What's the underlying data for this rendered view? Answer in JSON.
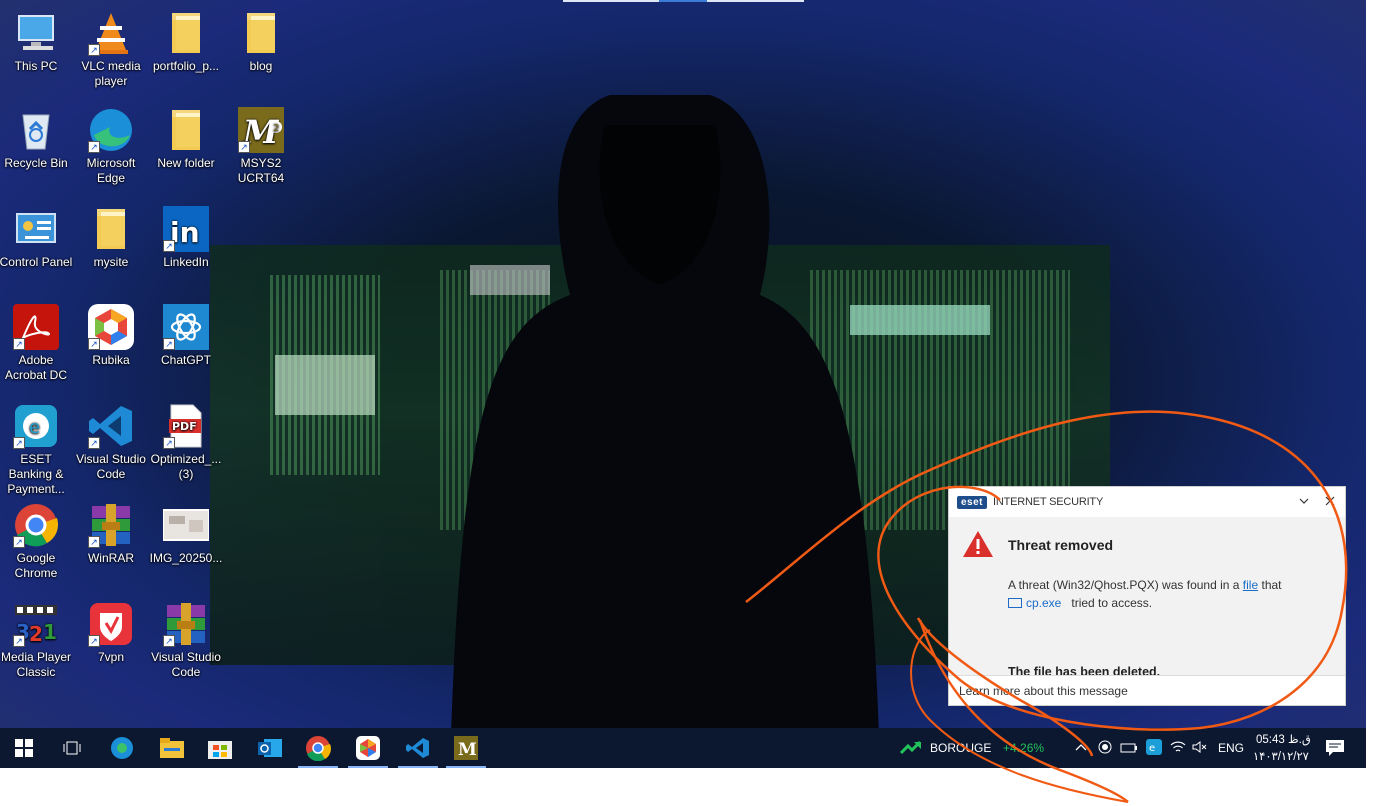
{
  "desktop": {
    "icons": [
      {
        "label": "This PC",
        "icon": "computer-icon"
      },
      {
        "label": "VLC media player",
        "icon": "vlc-icon"
      },
      {
        "label": "portfolio_p...",
        "icon": "folder-icon"
      },
      {
        "label": "blog",
        "icon": "folder-icon"
      },
      {
        "label": "Recycle Bin",
        "icon": "recycle-bin-icon"
      },
      {
        "label": "Microsoft Edge",
        "icon": "edge-icon"
      },
      {
        "label": "New folder",
        "icon": "folder-icon"
      },
      {
        "label": "MSYS2 UCRT64",
        "icon": "msys2-icon"
      },
      {
        "label": "Control Panel",
        "icon": "control-panel-icon"
      },
      {
        "label": "mysite",
        "icon": "folder-icon"
      },
      {
        "label": "LinkedIn",
        "icon": "linkedin-icon"
      },
      {
        "label": "Adobe Acrobat DC",
        "icon": "acrobat-icon"
      },
      {
        "label": "Rubika",
        "icon": "rubika-icon"
      },
      {
        "label": "ChatGPT",
        "icon": "chatgpt-icon"
      },
      {
        "label": "ESET Banking & Payment...",
        "icon": "eset-banking-icon"
      },
      {
        "label": "Visual Studio Code",
        "icon": "vscode-icon"
      },
      {
        "label": "Optimized_... (3)",
        "icon": "pdf-icon"
      },
      {
        "label": "Google Chrome",
        "icon": "chrome-icon"
      },
      {
        "label": "WinRAR",
        "icon": "winrar-icon"
      },
      {
        "label": "IMG_20250...",
        "icon": "image-thumbnail-icon"
      },
      {
        "label": "Media Player Classic",
        "icon": "mpc-icon"
      },
      {
        "label": "7vpn",
        "icon": "7vpn-icon"
      },
      {
        "label": "Visual Studio Code",
        "icon": "winrar-icon"
      }
    ]
  },
  "toast": {
    "logo": "eset",
    "product": "INTERNET SECURITY",
    "title": "Threat removed",
    "message_prefix": "A threat (Win32/Qhost.PQX) was found in a",
    "message_link": "file",
    "message_suffix": "that",
    "file_name": "cp.exe",
    "message_end": "tried to access.",
    "deleted": "The file has been deleted.",
    "footer": "Learn more about this message",
    "collapse_icon": "chevron-down-icon",
    "close_icon": "close-icon"
  },
  "taskbar": {
    "apps": [
      "start-icon",
      "task-view-icon",
      "edge-icon",
      "file-explorer-icon",
      "store-icon",
      "outlook-icon",
      "chrome-icon",
      "rubika-icon",
      "vscode-icon",
      "msys2-icon"
    ],
    "stock_name": "BOROUGE",
    "stock_change": "+4.26%",
    "language": "ENG",
    "time": "05:43 ق.ظ",
    "date": "۱۴۰۳/۱۲/۲۷"
  }
}
